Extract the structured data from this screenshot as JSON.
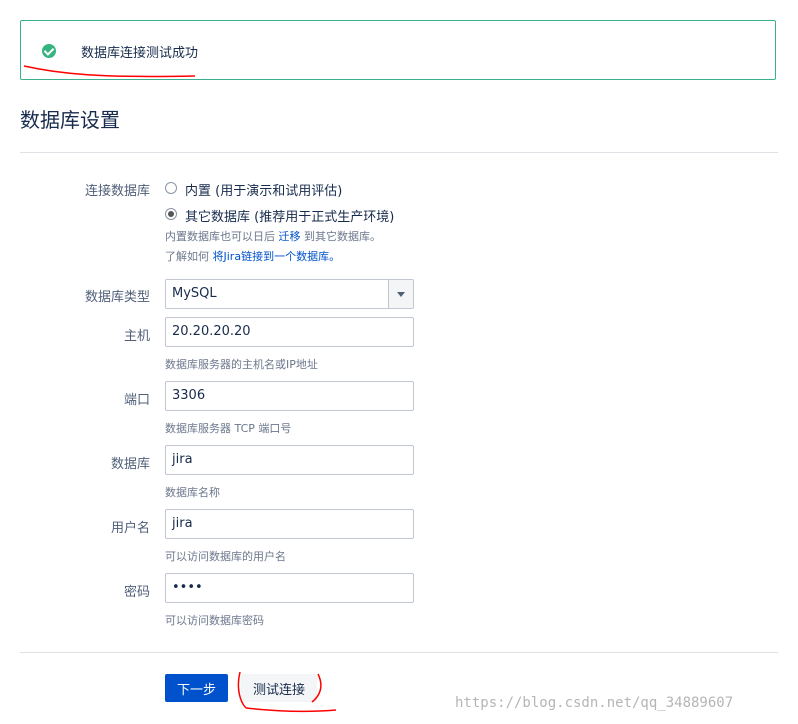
{
  "banner": {
    "message": "数据库连接测试成功"
  },
  "section_title": "数据库设置",
  "connection": {
    "label": "连接数据库",
    "options": [
      {
        "label": "内置 (用于演示和试用评估)",
        "selected": false
      },
      {
        "label": "其它数据库 (推荐用于正式生产环境)",
        "selected": true
      }
    ],
    "hint1_pre": "内置数据库也可以日后",
    "hint1_link": "迁移",
    "hint1_post": "到其它数据库。",
    "hint2_pre": "了解如何",
    "hint2_link": "将Jira链接到一个数据库。"
  },
  "db_type": {
    "label": "数据库类型",
    "value": "MySQL"
  },
  "host": {
    "label": "主机",
    "value": "20.20.20.20",
    "hint": "数据库服务器的主机名或IP地址"
  },
  "port": {
    "label": "端口",
    "value": "3306",
    "hint": "数据库服务器 TCP 端口号"
  },
  "database": {
    "label": "数据库",
    "value": "jira",
    "hint": "数据库名称"
  },
  "username": {
    "label": "用户名",
    "value": "jira",
    "hint": "可以访问数据库的用户名"
  },
  "password": {
    "label": "密码",
    "value": "••••",
    "hint": "可以访问数据库密码"
  },
  "buttons": {
    "next": "下一步",
    "test": "测试连接"
  },
  "watermark": "https://blog.csdn.net/qq_34889607",
  "colors": {
    "accent": "#0052cc",
    "success": "#36b37e",
    "annotation": "#ff0000"
  }
}
